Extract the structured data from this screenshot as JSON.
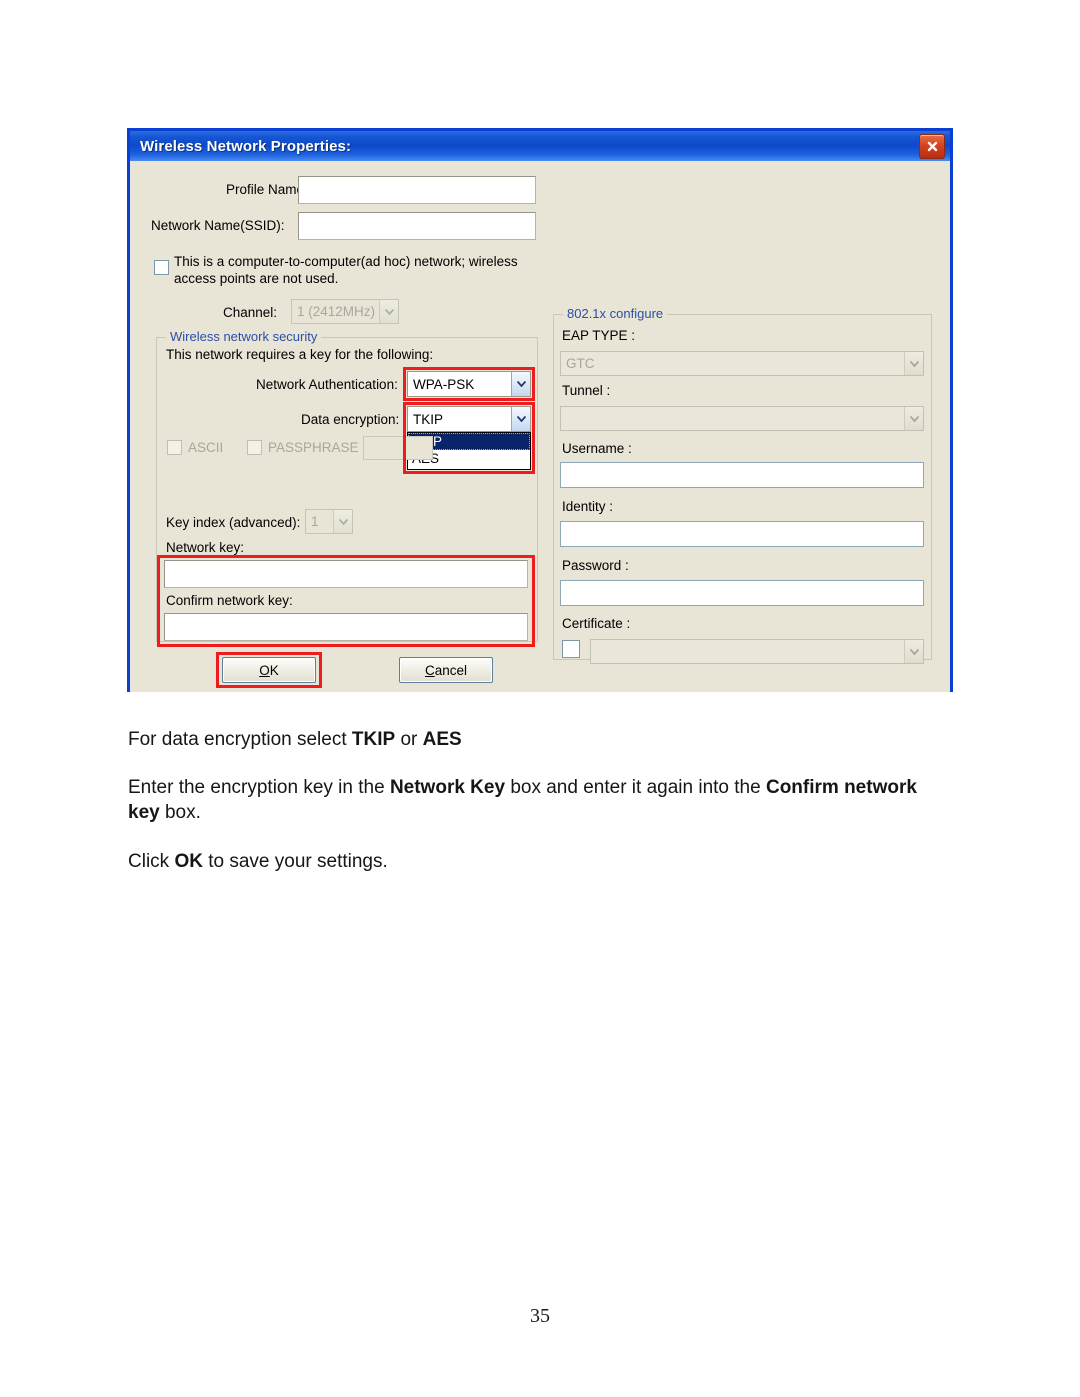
{
  "document": {
    "page_number": "35",
    "paragraphs": [
      {
        "id": "p1",
        "runs": [
          {
            "text": "For data encryption select ",
            "bold": false
          },
          {
            "text": "TKIP",
            "bold": true
          },
          {
            "text": " or ",
            "bold": false
          },
          {
            "text": "AES",
            "bold": true
          }
        ]
      },
      {
        "id": "p2",
        "runs": [
          {
            "text": "Enter the encryption key in the ",
            "bold": false
          },
          {
            "text": "Network Key",
            "bold": true
          },
          {
            "text": " box and enter it again into the ",
            "bold": false
          },
          {
            "text": "Confirm network key",
            "bold": true
          },
          {
            "text": " box.",
            "bold": false
          }
        ]
      },
      {
        "id": "p3",
        "runs": [
          {
            "text": "Click ",
            "bold": false
          },
          {
            "text": "OK",
            "bold": true
          },
          {
            "text": " to save your settings.",
            "bold": false
          }
        ]
      }
    ]
  },
  "dialog": {
    "title": "Wireless Network Properties:",
    "close_label": "close-icon",
    "fields": {
      "profile_name_label": "Profile Name:",
      "profile_name_value": "",
      "ssid_label": "Network Name(SSID):",
      "ssid_value": "",
      "adhoc_text_line1": "This is a computer-to-computer(ad hoc) network; wireless",
      "adhoc_text_line2": "access points are not used.",
      "adhoc_checked": false,
      "channel_label": "Channel:",
      "channel_value": "1  (2412MHz)"
    },
    "security_group": {
      "legend": "Wireless network security",
      "requires_key_text": "This network requires a key for the following:",
      "network_auth_label": "Network Authentication:",
      "network_auth_value": "WPA-PSK",
      "data_encryption_label": "Data encryption:",
      "data_encryption_value": "TKIP",
      "data_encryption_options": [
        "TKIP",
        "AES"
      ],
      "data_encryption_selected_index": 0,
      "ascii_label": "ASCII",
      "ascii_checked": false,
      "passphrase_label": "PASSPHRASE",
      "passphrase_checked": false,
      "key_index_label": "Key index (advanced):",
      "key_index_value": "1",
      "network_key_label": "Network key:",
      "network_key_value": "",
      "confirm_key_label": "Confirm network key:",
      "confirm_key_value": ""
    },
    "dot1x_group": {
      "legend": "802.1x configure",
      "eap_type_label": "EAP TYPE :",
      "eap_type_value": "GTC",
      "tunnel_label": "Tunnel :",
      "tunnel_value": "",
      "username_label": "Username :",
      "username_value": "",
      "identity_label": "Identity :",
      "identity_value": "",
      "password_label": "Password :",
      "password_value": "",
      "certificate_label": "Certificate :",
      "certificate_value": "",
      "certificate_checked": false
    },
    "buttons": {
      "ok_underline": "O",
      "ok_rest": "K",
      "cancel_underline": "C",
      "cancel_rest": "ancel"
    },
    "colors": {
      "titlebar_blue": "#0d49c9",
      "dialog_border": "#0b3fd4",
      "dialog_face": "#e8e5d7",
      "legend_blue": "#2b4ea8",
      "annotation_red": "#ee1c1c",
      "highlight_navy": "#0a246a",
      "close_red": "#d4431e"
    }
  }
}
